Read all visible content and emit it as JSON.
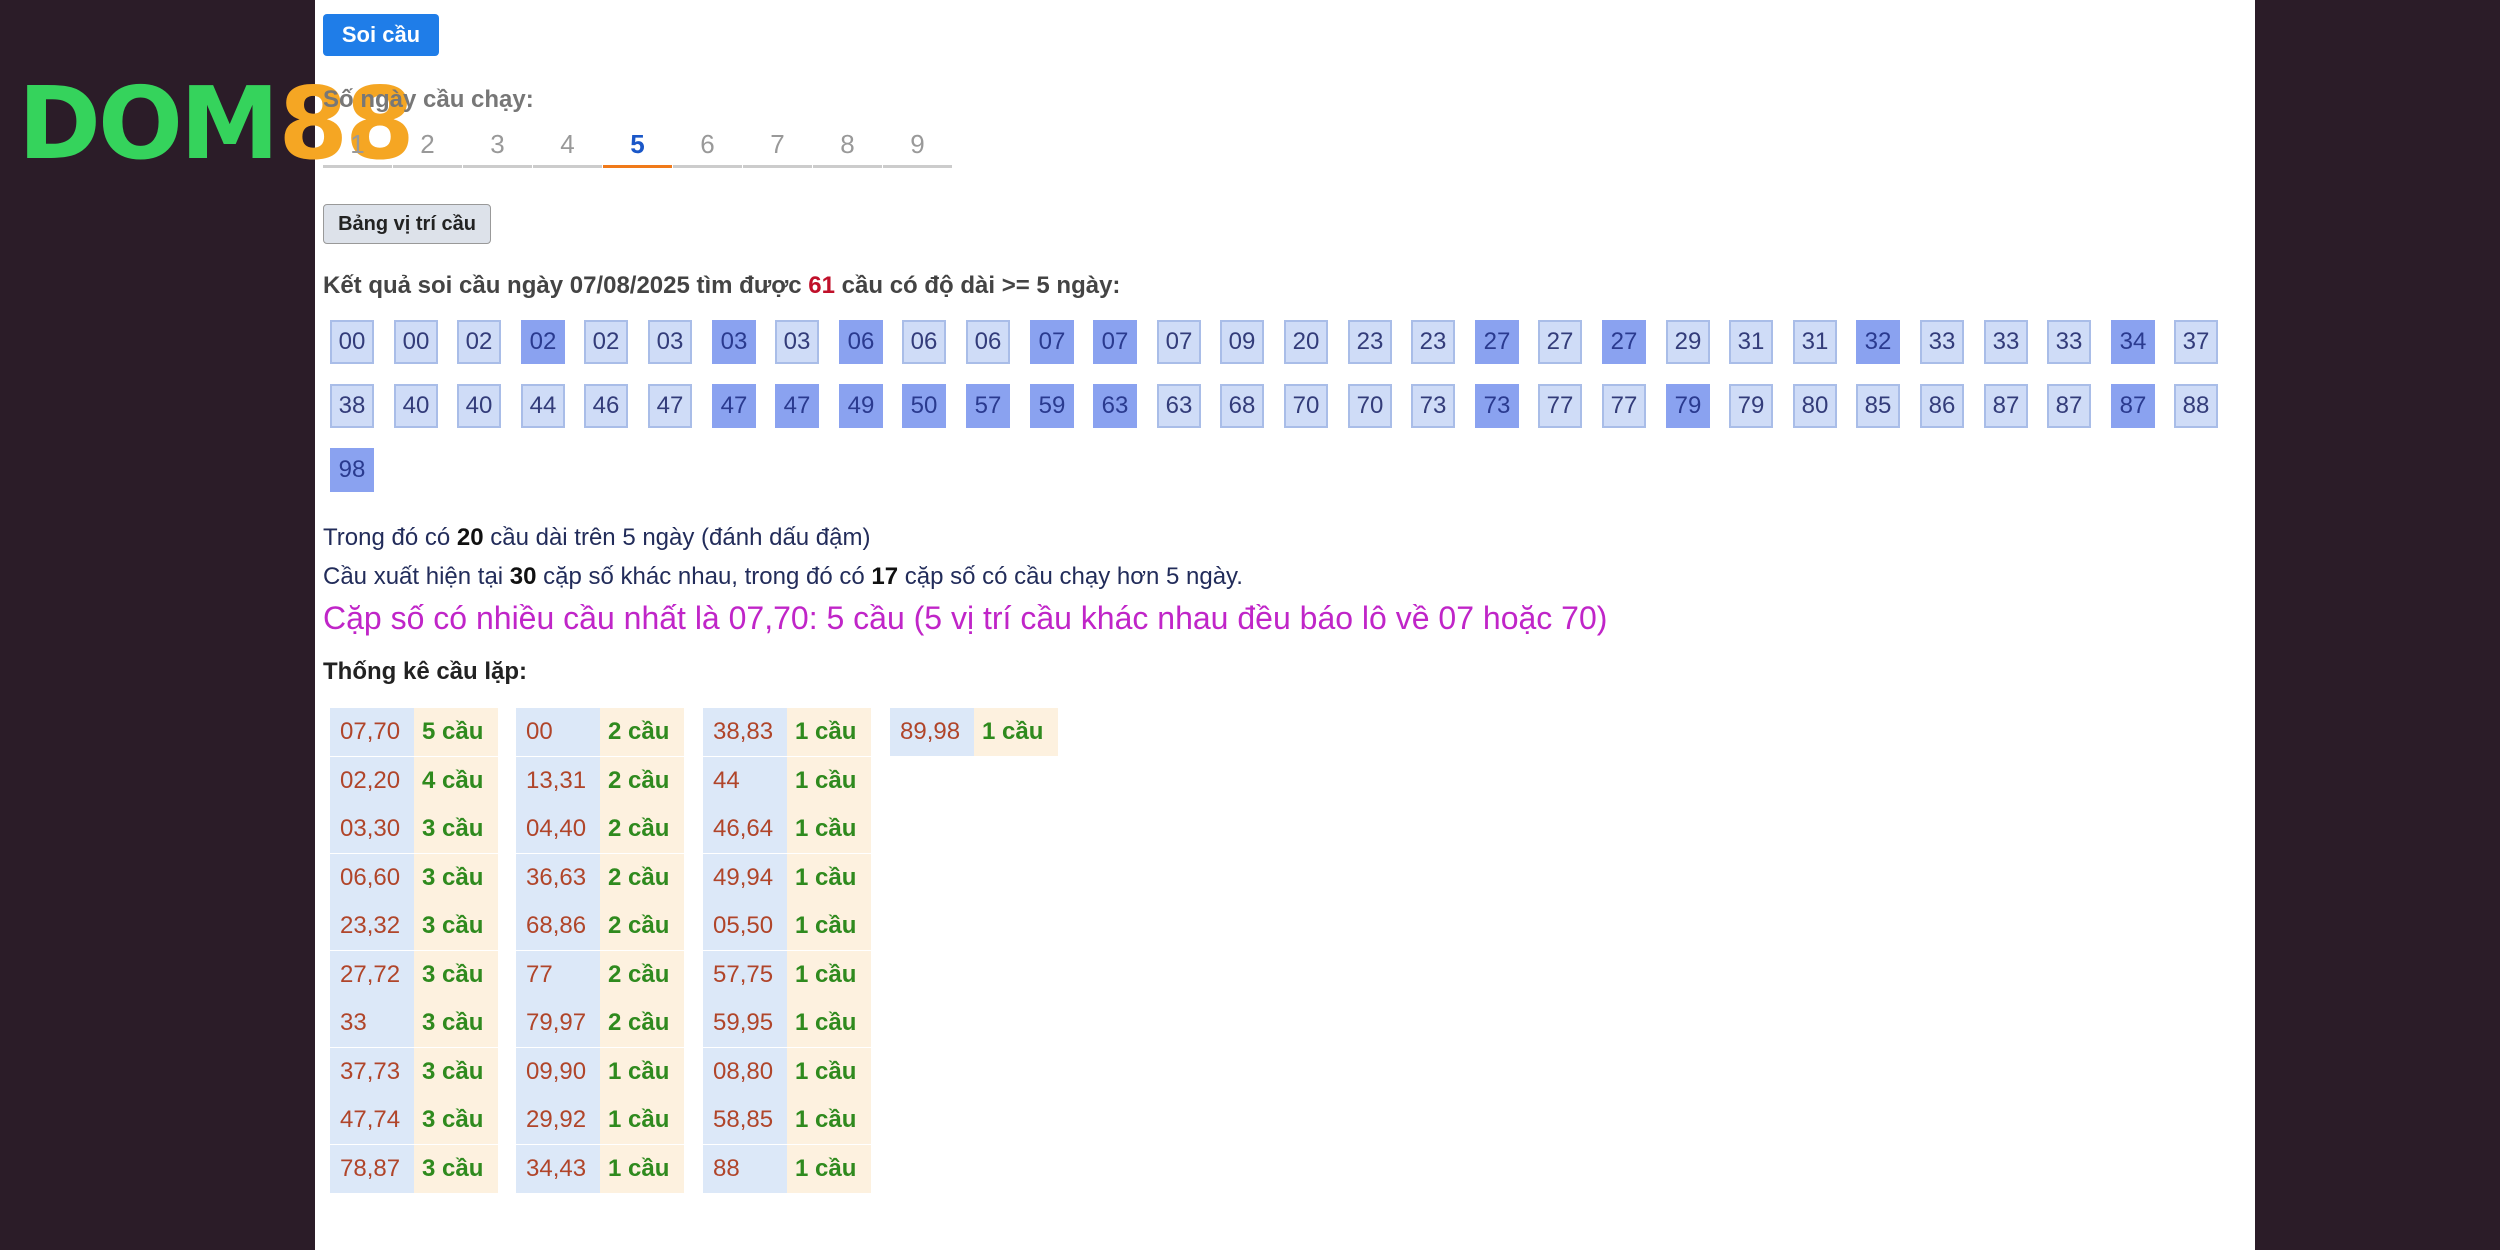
{
  "logo": {
    "green_text": "DOM",
    "orange_text": "88"
  },
  "soi_button": "Soi cầu",
  "days_label": "Số ngày cầu chạy:",
  "day_tabs": [
    "1",
    "2",
    "3",
    "4",
    "5",
    "6",
    "7",
    "8",
    "9"
  ],
  "active_day": "5",
  "table_button": "Bảng vị trí cầu",
  "result": {
    "prefix": "Kết quả soi cầu ngày 07/08/2025 tìm được ",
    "count": "61",
    "suffix": " cầu có độ dài >= 5 ngày:"
  },
  "numbers": [
    {
      "n": "00",
      "b": false
    },
    {
      "n": "00",
      "b": false
    },
    {
      "n": "02",
      "b": false
    },
    {
      "n": "02",
      "b": true
    },
    {
      "n": "02",
      "b": false
    },
    {
      "n": "03",
      "b": false
    },
    {
      "n": "03",
      "b": true
    },
    {
      "n": "03",
      "b": false
    },
    {
      "n": "06",
      "b": true
    },
    {
      "n": "06",
      "b": false
    },
    {
      "n": "06",
      "b": false
    },
    {
      "n": "07",
      "b": true
    },
    {
      "n": "07",
      "b": true
    },
    {
      "n": "07",
      "b": false
    },
    {
      "n": "09",
      "b": false
    },
    {
      "n": "20",
      "b": false
    },
    {
      "n": "23",
      "b": false
    },
    {
      "n": "23",
      "b": false
    },
    {
      "n": "27",
      "b": true
    },
    {
      "n": "27",
      "b": false
    },
    {
      "n": "27",
      "b": true
    },
    {
      "n": "29",
      "b": false
    },
    {
      "n": "31",
      "b": false
    },
    {
      "n": "31",
      "b": false
    },
    {
      "n": "32",
      "b": true
    },
    {
      "n": "33",
      "b": false
    },
    {
      "n": "33",
      "b": false
    },
    {
      "n": "33",
      "b": false
    },
    {
      "n": "34",
      "b": true
    },
    {
      "n": "37",
      "b": false
    },
    {
      "n": "38",
      "b": false
    },
    {
      "n": "40",
      "b": false
    },
    {
      "n": "40",
      "b": false
    },
    {
      "n": "44",
      "b": false
    },
    {
      "n": "46",
      "b": false
    },
    {
      "n": "47",
      "b": false
    },
    {
      "n": "47",
      "b": true
    },
    {
      "n": "47",
      "b": true
    },
    {
      "n": "49",
      "b": true
    },
    {
      "n": "50",
      "b": true
    },
    {
      "n": "57",
      "b": true
    },
    {
      "n": "59",
      "b": true
    },
    {
      "n": "63",
      "b": true
    },
    {
      "n": "63",
      "b": false
    },
    {
      "n": "68",
      "b": false
    },
    {
      "n": "70",
      "b": false
    },
    {
      "n": "70",
      "b": false
    },
    {
      "n": "73",
      "b": false
    },
    {
      "n": "73",
      "b": true
    },
    {
      "n": "77",
      "b": false
    },
    {
      "n": "77",
      "b": false
    },
    {
      "n": "79",
      "b": true
    },
    {
      "n": "79",
      "b": false
    },
    {
      "n": "80",
      "b": false
    },
    {
      "n": "85",
      "b": false
    },
    {
      "n": "86",
      "b": false
    },
    {
      "n": "87",
      "b": false
    },
    {
      "n": "87",
      "b": false
    },
    {
      "n": "87",
      "b": true
    },
    {
      "n": "88",
      "b": false
    },
    {
      "n": "98",
      "b": true
    }
  ],
  "info1": {
    "a": "Trong đó có ",
    "num": "20",
    "b": " cầu dài trên 5 ngày (đánh dấu đậm)"
  },
  "info2": {
    "a": "Cầu xuất hiện tại ",
    "num1": "30",
    "b": " cặp số khác nhau, trong đó có ",
    "num2": "17",
    "c": " cặp số có cầu chạy hơn 5 ngày."
  },
  "headline": "Cặp số có nhiều cầu nhất là 07,70: 5 cầu (5 vị trí cầu khác nhau đều báo lô về 07 hoặc 70)",
  "stats_title": "Thống kê cầu lặp:",
  "stats": [
    [
      [
        "07,70",
        "5 cầu"
      ],
      [
        "02,20",
        "4 cầu"
      ],
      [
        "03,30",
        "3 cầu"
      ],
      [
        "06,60",
        "3 cầu"
      ],
      [
        "23,32",
        "3 cầu"
      ],
      [
        "27,72",
        "3 cầu"
      ],
      [
        "33",
        "3 cầu"
      ],
      [
        "37,73",
        "3 cầu"
      ],
      [
        "47,74",
        "3 cầu"
      ],
      [
        "78,87",
        "3 cầu"
      ]
    ],
    [
      [
        "00",
        "2 cầu"
      ],
      [
        "13,31",
        "2 cầu"
      ],
      [
        "04,40",
        "2 cầu"
      ],
      [
        "36,63",
        "2 cầu"
      ],
      [
        "68,86",
        "2 cầu"
      ],
      [
        "77",
        "2 cầu"
      ],
      [
        "79,97",
        "2 cầu"
      ],
      [
        "09,90",
        "1 cầu"
      ],
      [
        "29,92",
        "1 cầu"
      ],
      [
        "34,43",
        "1 cầu"
      ]
    ],
    [
      [
        "38,83",
        "1 cầu"
      ],
      [
        "44",
        "1 cầu"
      ],
      [
        "46,64",
        "1 cầu"
      ],
      [
        "49,94",
        "1 cầu"
      ],
      [
        "05,50",
        "1 cầu"
      ],
      [
        "57,75",
        "1 cầu"
      ],
      [
        "59,95",
        "1 cầu"
      ],
      [
        "08,80",
        "1 cầu"
      ],
      [
        "58,85",
        "1 cầu"
      ],
      [
        "88",
        "1 cầu"
      ]
    ],
    [
      [
        "89,98",
        "1 cầu"
      ]
    ]
  ]
}
